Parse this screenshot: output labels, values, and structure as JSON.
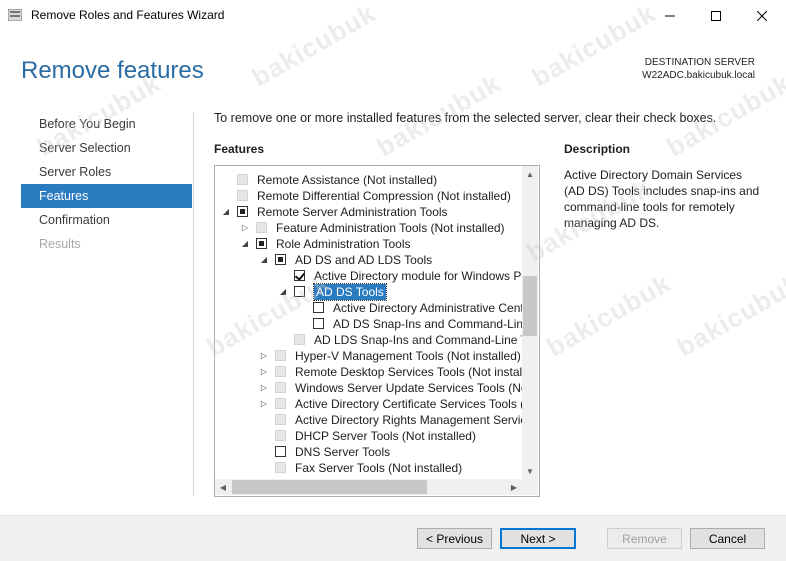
{
  "window": {
    "title": "Remove Roles and Features Wizard",
    "minimize_glyph": "—",
    "maximize_glyph": "☐",
    "close_glyph": "✕"
  },
  "header": {
    "title": "Remove features",
    "destination_label": "DESTINATION SERVER",
    "destination_server": "W22ADC.bakicubuk.local"
  },
  "nav": {
    "items": [
      {
        "label": "Before You Begin",
        "state": "normal"
      },
      {
        "label": "Server Selection",
        "state": "normal"
      },
      {
        "label": "Server Roles",
        "state": "normal"
      },
      {
        "label": "Features",
        "state": "active"
      },
      {
        "label": "Confirmation",
        "state": "normal"
      },
      {
        "label": "Results",
        "state": "disabled"
      }
    ]
  },
  "main": {
    "instruction": "To remove one or more installed features from the selected server, clear their check boxes.",
    "features_heading": "Features",
    "description_heading": "Description",
    "description_text": "Active Directory Domain Services (AD DS) Tools includes snap-ins and command-line tools for remotely managing AD DS."
  },
  "tree": {
    "rows": [
      {
        "label": "Remote Assistance (Not installed)",
        "level": 0,
        "expander": "",
        "check": "gray"
      },
      {
        "label": "Remote Differential Compression (Not installed)",
        "level": 0,
        "expander": "",
        "check": "gray"
      },
      {
        "label": "Remote Server Administration Tools",
        "level": 0,
        "expander": "◢",
        "check": "partial"
      },
      {
        "label": "Feature Administration Tools (Not installed)",
        "level": 1,
        "expander": "▷",
        "check": "gray"
      },
      {
        "label": "Role Administration Tools",
        "level": 1,
        "expander": "◢",
        "check": "partial"
      },
      {
        "label": "AD DS and AD LDS Tools",
        "level": 2,
        "expander": "◢",
        "check": "partial"
      },
      {
        "label": "Active Directory module for Windows PowerShell",
        "level": 3,
        "expander": "",
        "check": "checked"
      },
      {
        "label": "AD DS Tools",
        "level": 3,
        "expander": "◢",
        "check": "empty",
        "selected": true
      },
      {
        "label": "Active Directory Administrative Center",
        "level": 4,
        "expander": "",
        "check": "empty"
      },
      {
        "label": "AD DS Snap-Ins and Command-Line Tools",
        "level": 4,
        "expander": "",
        "check": "empty"
      },
      {
        "label": "AD LDS Snap-Ins and Command-Line Tools",
        "level": 3,
        "expander": "",
        "check": "gray"
      },
      {
        "label": "Hyper-V Management Tools (Not installed)",
        "level": 2,
        "expander": "▷",
        "check": "gray"
      },
      {
        "label": "Remote Desktop Services Tools (Not installed)",
        "level": 2,
        "expander": "▷",
        "check": "gray"
      },
      {
        "label": "Windows Server Update Services Tools (Not installed)",
        "level": 2,
        "expander": "▷",
        "check": "gray"
      },
      {
        "label": "Active Directory Certificate Services Tools (Not installed)",
        "level": 2,
        "expander": "▷",
        "check": "gray"
      },
      {
        "label": "Active Directory Rights Management Services Tools",
        "level": 2,
        "expander": "",
        "check": "gray"
      },
      {
        "label": "DHCP Server Tools (Not installed)",
        "level": 2,
        "expander": "",
        "check": "gray"
      },
      {
        "label": "DNS Server Tools",
        "level": 2,
        "expander": "",
        "check": "empty"
      },
      {
        "label": "Fax Server Tools (Not installed)",
        "level": 2,
        "expander": "",
        "check": "gray"
      }
    ]
  },
  "footer": {
    "previous": "< Previous",
    "next": "Next >",
    "remove": "Remove",
    "cancel": "Cancel"
  },
  "watermark": "bakicubuk",
  "colors": {
    "accent": "#2b7bc1",
    "title_blue": "#2b6ba3"
  }
}
